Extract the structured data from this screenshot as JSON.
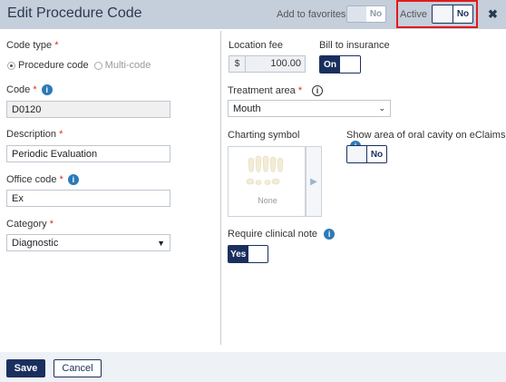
{
  "header": {
    "title": "Edit Procedure Code",
    "favorites_label": "Add to favorites",
    "favorites_value": "No",
    "active_label": "Active",
    "active_value": "No",
    "close_symbol": "✖"
  },
  "left": {
    "code_type_label": "Code type",
    "code_type_options": [
      "Procedure code",
      "Multi-code"
    ],
    "code_label": "Code",
    "code_value": "D0120",
    "description_label": "Description",
    "description_value": "Periodic Evaluation",
    "office_code_label": "Office code",
    "office_code_value": "Ex",
    "category_label": "Category",
    "category_value": "Diagnostic"
  },
  "right": {
    "location_fee_label": "Location fee",
    "location_fee_prefix": "$",
    "location_fee_value": "100.00",
    "bill_insurance_label": "Bill to insurance",
    "bill_insurance_value": "On",
    "treatment_area_label": "Treatment area",
    "treatment_area_value": "Mouth",
    "charting_symbol_label": "Charting symbol",
    "charting_none": "None",
    "show_area_label": "Show area of oral cavity on eClaims",
    "show_area_value": "No",
    "require_note_label": "Require clinical note",
    "require_note_value": "Yes"
  },
  "footer": {
    "save_label": "Save",
    "cancel_label": "Cancel"
  },
  "required_mark": "*",
  "info_glyph": "i",
  "colors": {
    "header_bg": "#c5cedb",
    "primary": "#1a2f5e",
    "info_blue": "#2c7ab8",
    "highlight_red": "#e01b1b"
  }
}
